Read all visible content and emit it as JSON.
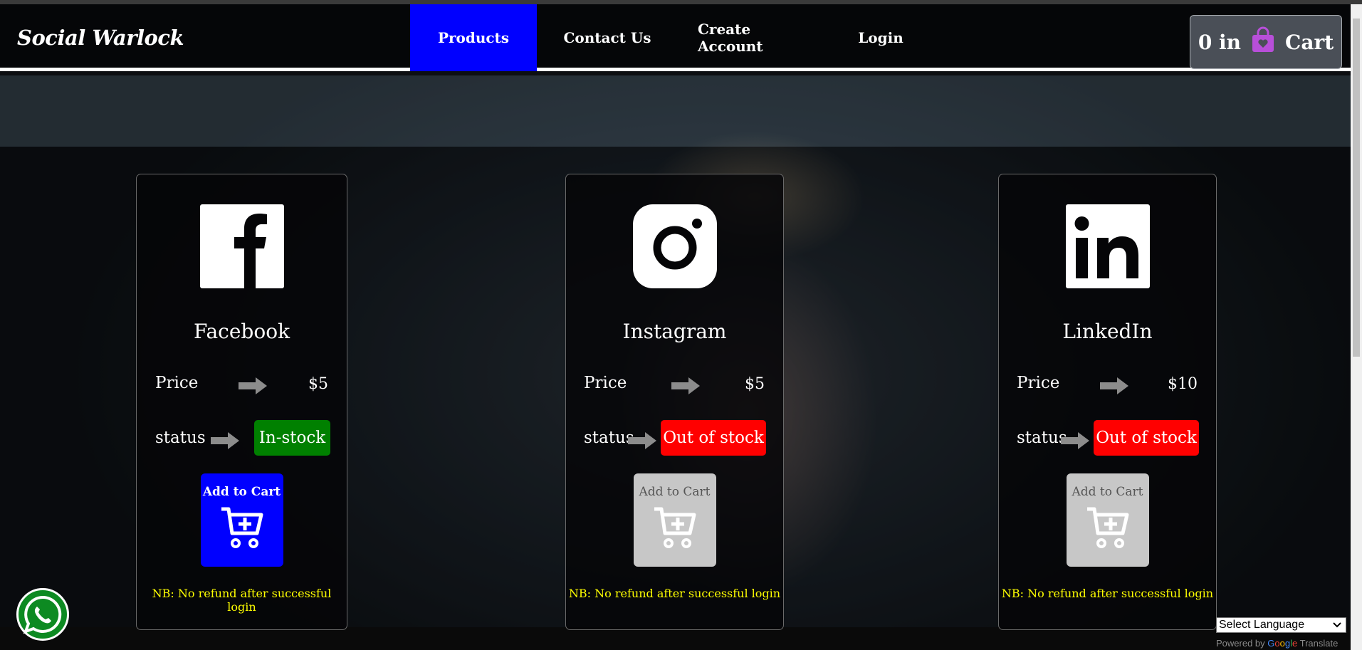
{
  "brand": "Social Warlock",
  "nav": {
    "items": [
      "Products",
      "Contact Us",
      "Create Account",
      "Login"
    ],
    "active": "Products"
  },
  "cart": {
    "count": "0 in",
    "label": "Cart",
    "icon": "shopping-bag-icon",
    "icon_color": "#b84fd9"
  },
  "products": [
    {
      "name": "Facebook",
      "icon": "facebook-icon",
      "price_label": "Price",
      "price": "$5",
      "status_label": "status",
      "status": "In-stock",
      "status_color": "#008000",
      "add_label": "Add to Cart",
      "add_enabled": true,
      "note": "NB: No refund after successful login"
    },
    {
      "name": "Instagram",
      "icon": "instagram-icon",
      "price_label": "Price",
      "price": "$5",
      "status_label": "status",
      "status": "Out of stock",
      "status_color": "#ff0000",
      "add_label": "Add to Cart",
      "add_enabled": false,
      "note": "NB: No refund after successful login"
    },
    {
      "name": "LinkedIn",
      "icon": "linkedin-icon",
      "price_label": "Price",
      "price": "$10",
      "status_label": "status",
      "status": "Out of stock",
      "status_color": "#ff0000",
      "add_label": "Add to Cart",
      "add_enabled": false,
      "note": "NB: No refund after successful login"
    }
  ],
  "translate": {
    "select_label": "Select Language",
    "powered_by": "Powered by",
    "google": [
      "G",
      "o",
      "o",
      "g",
      "l",
      "e"
    ],
    "translate": "Translate"
  },
  "colors": {
    "nav_active": "#0000ff",
    "add_enabled": "#0000ff",
    "add_disabled": "#c7c7c7",
    "note": "#ffff00",
    "whatsapp": "#0d8a22"
  }
}
